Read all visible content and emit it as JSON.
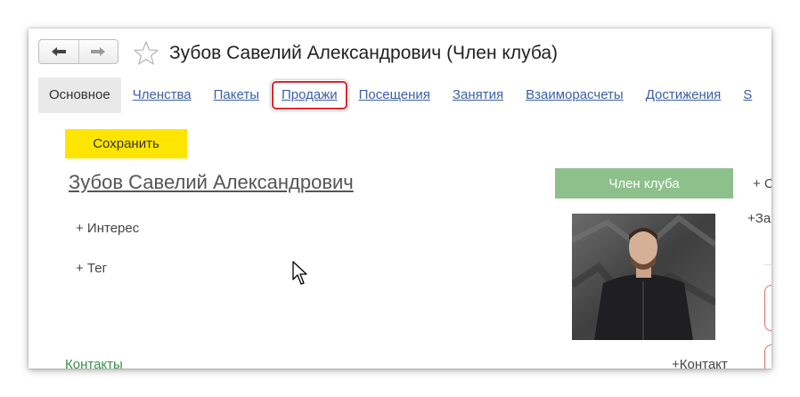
{
  "header": {
    "back_icon": "arrow-left-icon",
    "forward_icon": "arrow-right-icon",
    "favorite_icon": "star-outline-icon",
    "title": "Зубов Савелий Александрович (Член клуба)"
  },
  "tabs": [
    {
      "label": "Основное",
      "active": true
    },
    {
      "label": "Членства"
    },
    {
      "label": "Пакеты"
    },
    {
      "label": "Продажи",
      "highlighted": true
    },
    {
      "label": "Посещения"
    },
    {
      "label": "Занятия"
    },
    {
      "label": "Взаиморасчеты"
    },
    {
      "label": "Достижения"
    },
    {
      "label": "S"
    }
  ],
  "toolbar": {
    "save_label": "Сохранить"
  },
  "client": {
    "name": "Зубов Савелий Александрович",
    "add_interest": "+ Интерес",
    "add_tag": "+ Тег",
    "status": "Член клуба"
  },
  "right_panel": {
    "item1": "+ С",
    "item2": "+За"
  },
  "contacts": {
    "label": "Контакты",
    "add_label": "+Контакт"
  },
  "colors": {
    "accent": "#fde500",
    "link": "#3b5fa5",
    "status": "#8dc08b",
    "highlight": "#d9272d"
  }
}
